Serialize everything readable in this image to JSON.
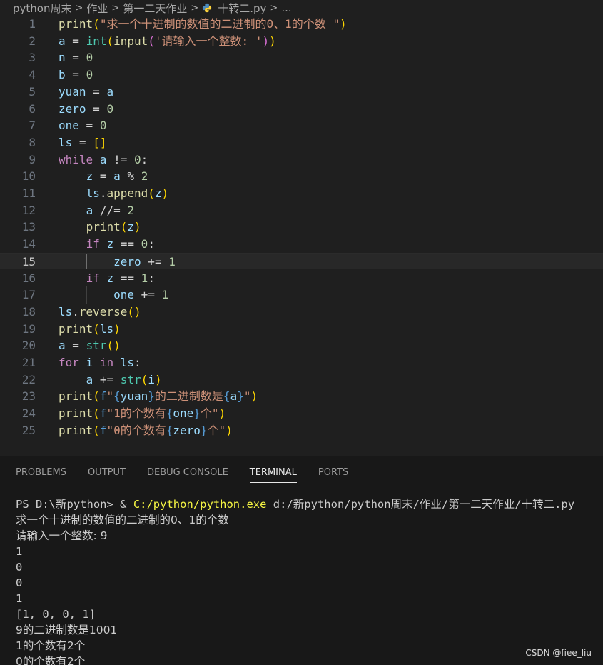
{
  "breadcrumb": {
    "items": [
      "python周末",
      "作业",
      "第一二天作业",
      "十转二.py",
      "..."
    ]
  },
  "editor": {
    "active_line": 15,
    "line_numbers": [
      "1",
      "2",
      "3",
      "4",
      "5",
      "6",
      "7",
      "8",
      "9",
      "10",
      "11",
      "12",
      "13",
      "14",
      "15",
      "16",
      "17",
      "18",
      "19",
      "20",
      "21",
      "22",
      "23",
      "24",
      "25"
    ],
    "lines": [
      "print(\"求一个十进制的数值的二进制的0、1的个数 \")",
      "a = int(input('请输入一个整数: '))",
      "n = 0",
      "b = 0",
      "yuan = a",
      "zero = 0",
      "one = 0",
      "ls = []",
      "while a != 0:",
      "    z = a % 2",
      "    ls.append(z)",
      "    a //= 2",
      "    print(z)",
      "    if z == 0:",
      "        zero += 1",
      "    if z == 1:",
      "        one += 1",
      "ls.reverse()",
      "print(ls)",
      "a = str()",
      "for i in ls:",
      "    a += str(i)",
      "print(f\"{yuan}的二进制数是{a}\")",
      "print(f\"1的个数有{one}个\")",
      "print(f\"0的个数有{zero}个\")"
    ]
  },
  "panel": {
    "tabs": [
      "PROBLEMS",
      "OUTPUT",
      "DEBUG CONSOLE",
      "TERMINAL",
      "PORTS"
    ],
    "active_tab": "TERMINAL",
    "terminal": {
      "prompt": "PS D:\\新python> & ",
      "exe": "C:/python/python.exe",
      "script": " d:/新python/python周末/作业/第一二天作业/十转二.py",
      "output": [
        "求一个十进制的数值的二进制的0、1的个数",
        "请输入一个整数: 9",
        "1",
        "0",
        "0",
        "1",
        "[1, 0, 0, 1]",
        "9的二进制数是1001",
        "1的个数有2个",
        "0的个数有2个"
      ]
    }
  },
  "watermark": "CSDN @fiee_liu",
  "colors": {
    "background": "#1f1f1f",
    "function": "#dcdcaa",
    "string": "#ce9178",
    "number": "#b5cea8",
    "keyword": "#c586c0",
    "variable": "#9cdcfe"
  }
}
